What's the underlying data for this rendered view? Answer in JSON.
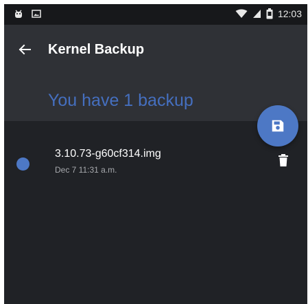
{
  "status_bar": {
    "time": "12:03",
    "left_icons": [
      "android-robot-icon",
      "image-icon"
    ],
    "right_icons": [
      "wifi-icon",
      "cellular-signal-icon",
      "battery-icon"
    ]
  },
  "app_bar": {
    "title": "Kernel Backup",
    "back_icon": "arrow-left-icon",
    "summary": "You have 1 backup"
  },
  "fab": {
    "icon": "floppy-save-icon"
  },
  "backups": [
    {
      "file_name": "3.10.73-g60cf314.img",
      "date": "Dec 7 11:31 a.m.",
      "delete_icon": "trash-icon"
    }
  ],
  "colors": {
    "background": "#202226",
    "app_bar": "#2f3136",
    "status_bar": "#17181b",
    "accent": "#4d78c5",
    "summary_text": "#456fbf",
    "primary_text": "#ffffff",
    "secondary_text": "#a8aaae"
  }
}
